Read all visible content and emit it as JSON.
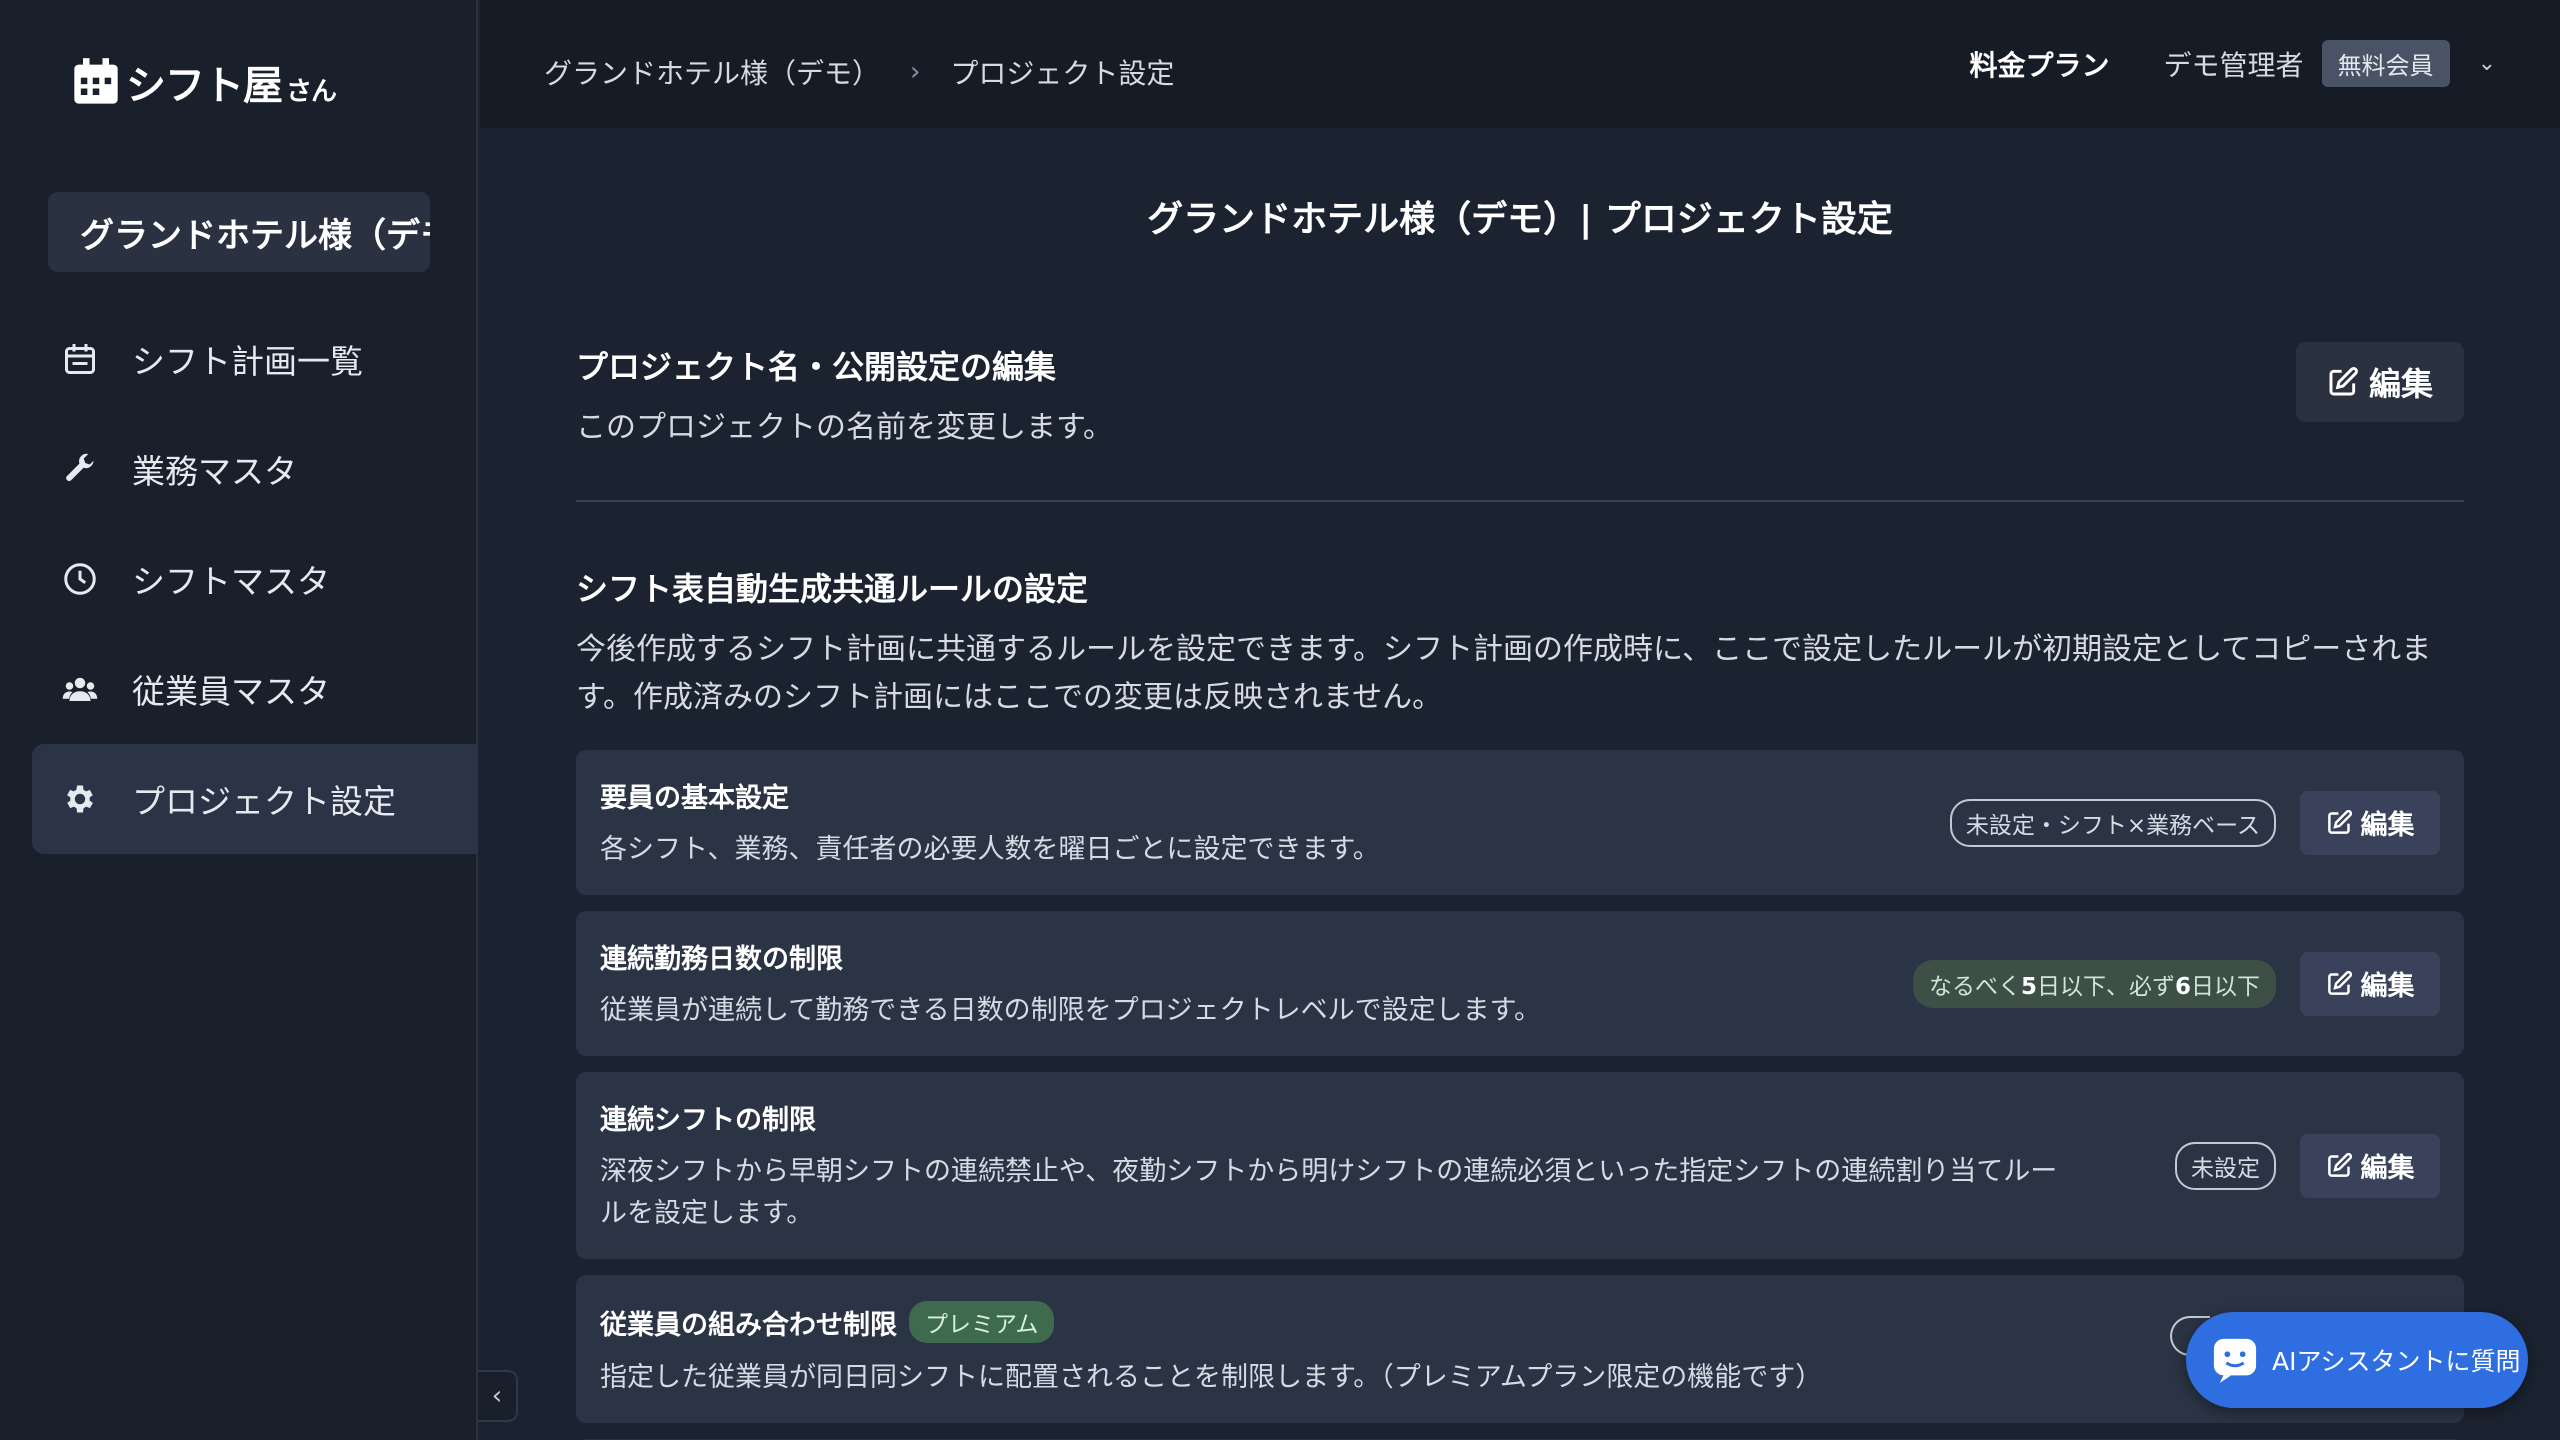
{
  "app": {
    "logo_text": "シフト屋",
    "logo_suffix": "さん"
  },
  "sidebar": {
    "project_name": "グランドホテル様（デモ）",
    "items": [
      {
        "label": "シフト計画一覧",
        "icon": "calendar-icon",
        "active": false
      },
      {
        "label": "業務マスタ",
        "icon": "wrench-icon",
        "active": false
      },
      {
        "label": "シフトマスタ",
        "icon": "clock-icon",
        "active": false
      },
      {
        "label": "従業員マスタ",
        "icon": "users-icon",
        "active": false
      },
      {
        "label": "プロジェクト設定",
        "icon": "gear-icon",
        "active": true
      }
    ],
    "collapse_icon": "‹"
  },
  "topbar": {
    "breadcrumb": [
      "グランドホテル様（デモ）",
      "プロジェクト設定"
    ],
    "breadcrumb_sep": "›",
    "pricing_label": "料金プラン",
    "user_name": "デモ管理者",
    "membership_badge": "無料会員",
    "menu_chevron": "⌄"
  },
  "main": {
    "page_title": "グランドホテル様（デモ）| プロジェクト設定",
    "project_section": {
      "heading": "プロジェクト名・公開設定の編集",
      "description": "このプロジェクトの名前を変更します。",
      "edit_label": "編集"
    },
    "rules_section": {
      "heading": "シフト表自動生成共通ルールの設定",
      "description": "今後作成するシフト計画に共通するルールを設定できます。シフト計画の作成時に、ここで設定したルールが初期設定としてコピーされます。作成済みのシフト計画にはここでの変更は反映されません。",
      "cards": [
        {
          "title": "要員の基本設定",
          "description": "各シフト、業務、責任者の必要人数を曜日ごとに設定できます。",
          "status": "未設定・シフト×業務ベース",
          "edit_label": "編集"
        },
        {
          "title": "連続勤務日数の制限",
          "description": "従業員が連続して勤務できる日数の制限をプロジェクトレベルで設定します。",
          "status_prefix": "なるべく",
          "status_num1": "5",
          "status_mid": "日以下、必ず",
          "status_num2": "6",
          "status_suffix": "日以下",
          "edit_label": "編集"
        },
        {
          "title": "連続シフトの制限",
          "description": "深夜シフトから早朝シフトの連続禁止や、夜勤シフトから明けシフトの連続必須といった指定シフトの連続割り当てルールを設定します。",
          "status": "未設定",
          "edit_label": "編集"
        },
        {
          "title": "従業員の組み合わせ制限",
          "tag": "プレミアム",
          "description": "指定した従業員が同日同シフトに配置されることを制限します。（プレミアムプラン限定の機能です）"
        }
      ]
    }
  },
  "assistant": {
    "label": "AIアシスタントに質問",
    "icon": "chat-icon"
  },
  "colors": {
    "accent": "#2e6ee0",
    "background": "#1b2230",
    "card": "#2b3444",
    "premium": "#3e6b4e"
  }
}
